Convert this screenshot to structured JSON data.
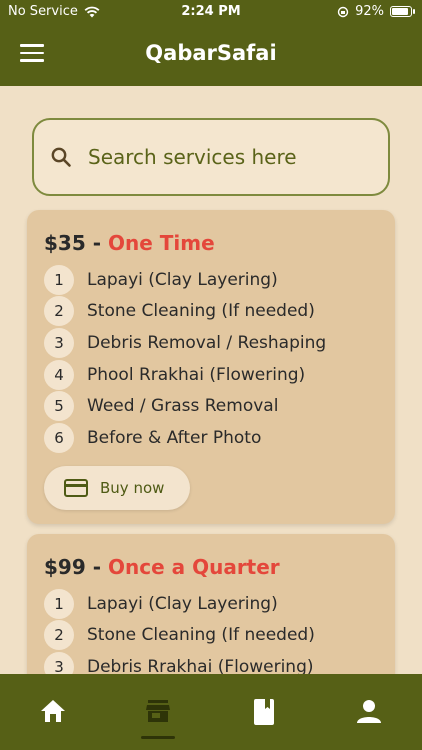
{
  "status_bar": {
    "carrier": "No Service",
    "time": "2:24 PM",
    "battery": "92%",
    "battery_level": 0.92
  },
  "app": {
    "title": "QabarSafai"
  },
  "search": {
    "placeholder": "Search services here"
  },
  "plans": [
    {
      "price": "$35",
      "separator": "-",
      "name": "One Time",
      "features": [
        {
          "num": "1",
          "text": "Lapayi (Clay Layering)"
        },
        {
          "num": "2",
          "text": "Stone Cleaning (If needed)"
        },
        {
          "num": "3",
          "text": "Debris Removal / Reshaping"
        },
        {
          "num": "4",
          "text": "Phool Rrakhai (Flowering)"
        },
        {
          "num": "5",
          "text": "Weed / Grass Removal"
        },
        {
          "num": "6",
          "text": "Before & After Photo"
        }
      ],
      "button": "Buy now"
    },
    {
      "price": "$99",
      "separator": "-",
      "name": "Once a Quarter",
      "features": [
        {
          "num": "1",
          "text": "Lapayi (Clay Layering)"
        },
        {
          "num": "2",
          "text": "Stone Cleaning (If needed)"
        },
        {
          "num": "3",
          "text": "Debris Rrakhai (Flowering)"
        }
      ]
    }
  ],
  "nav": {
    "items": [
      "home-icon",
      "store-icon",
      "book-icon",
      "person-icon"
    ],
    "selected": "store-icon"
  },
  "colors": {
    "primary": "#566016",
    "background": "#F0E0C6",
    "card": "#E2C7A0",
    "accent": "#E4473B"
  }
}
